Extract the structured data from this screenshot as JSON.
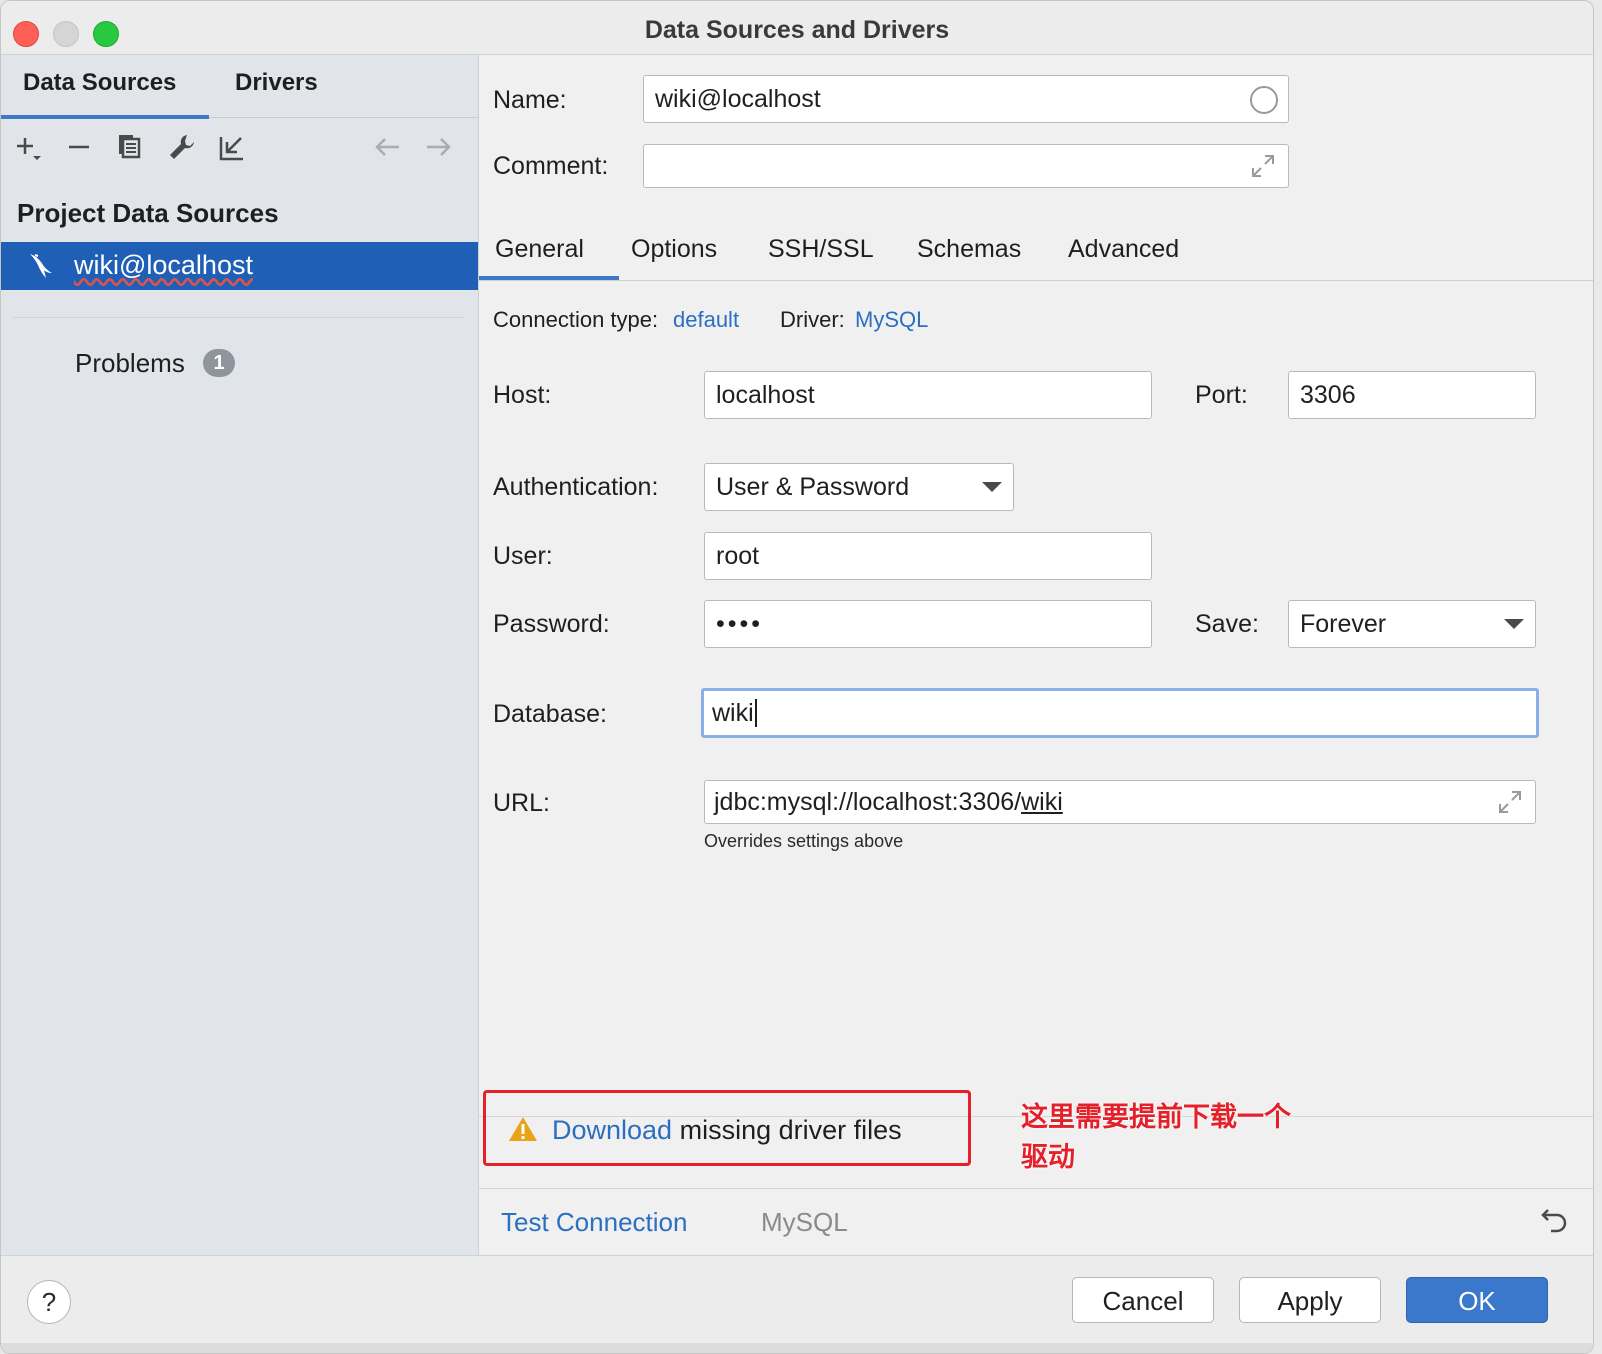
{
  "window": {
    "title": "Data Sources and Drivers"
  },
  "left": {
    "tabs": [
      "Data Sources",
      "Drivers"
    ],
    "toolbar_icons": [
      "add-icon",
      "remove-icon",
      "duplicate-icon",
      "wrench-icon",
      "import-icon",
      "back-arrow-icon",
      "forward-arrow-icon"
    ],
    "section_title": "Project Data Sources",
    "items": [
      {
        "label": "wiki@localhost",
        "icon": "mysql-dolphin-icon",
        "selected": true
      }
    ],
    "problems": {
      "label": "Problems",
      "count": "1"
    }
  },
  "form": {
    "name_label": "Name:",
    "name_value": "wiki@localhost",
    "comment_label": "Comment:",
    "comment_value": "",
    "tabs": [
      "General",
      "Options",
      "SSH/SSL",
      "Schemas",
      "Advanced"
    ],
    "active_tab": "General",
    "connection_type_label": "Connection type:",
    "connection_type_value": "default",
    "driver_label": "Driver:",
    "driver_value": "MySQL",
    "host_label": "Host:",
    "host_value": "localhost",
    "port_label": "Port:",
    "port_value": "3306",
    "auth_label": "Authentication:",
    "auth_value": "User & Password",
    "user_label": "User:",
    "user_value": "root",
    "password_label": "Password:",
    "password_value": "••••",
    "save_label": "Save:",
    "save_value": "Forever",
    "database_label": "Database:",
    "database_value": "wiki",
    "url_label": "URL:",
    "url_prefix": "jdbc:mysql://localhost:3306/",
    "url_db": "wiki",
    "url_hint": "Overrides settings above"
  },
  "warning": {
    "link": "Download",
    "text": " missing driver files"
  },
  "annotation": {
    "line1": "这里需要提前下载一个",
    "line2": "驱动"
  },
  "test": {
    "link": "Test Connection",
    "driver": "MySQL"
  },
  "footer": {
    "help": "?",
    "cancel": "Cancel",
    "apply": "Apply",
    "ok": "OK"
  },
  "colors": {
    "accent": "#3d79c8",
    "selection": "#1f5fb5",
    "link": "#2c6fc1",
    "annotation_red": "#e4202a",
    "ok_button": "#3a78cc"
  }
}
